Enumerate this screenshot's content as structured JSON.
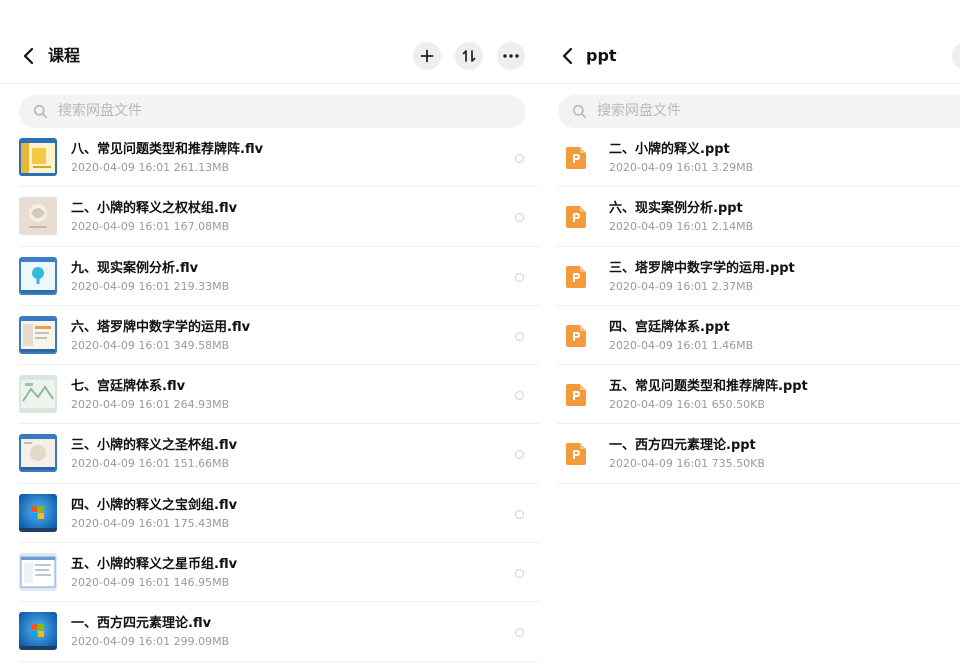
{
  "left": {
    "title": "课程",
    "search_placeholder": "搜索网盘文件",
    "files": [
      {
        "name": "八、常见问题类型和推荐牌阵.flv",
        "date": "2020-04-09",
        "time": "16:01",
        "size": "261.13MB",
        "thumb": "yellow-doc"
      },
      {
        "name": "二、小牌的释义之权杖组.flv",
        "date": "2020-04-09",
        "time": "16:01",
        "size": "167.08MB",
        "thumb": "beige-sketch"
      },
      {
        "name": "九、现实案例分析.flv",
        "date": "2020-04-09",
        "time": "16:01",
        "size": "219.33MB",
        "thumb": "blue-screen"
      },
      {
        "name": "六、塔罗牌中数字学的运用.flv",
        "date": "2020-04-09",
        "time": "16:01",
        "size": "349.58MB",
        "thumb": "window-doc"
      },
      {
        "name": "七、宫廷牌体系.flv",
        "date": "2020-04-09",
        "time": "16:01",
        "size": "264.93MB",
        "thumb": "green-map"
      },
      {
        "name": "三、小牌的释义之圣杯组.flv",
        "date": "2020-04-09",
        "time": "16:01",
        "size": "151.66MB",
        "thumb": "window-doc"
      },
      {
        "name": "四、小牌的释义之宝剑组.flv",
        "date": "2020-04-09",
        "time": "16:01",
        "size": "175.43MB",
        "thumb": "windows7"
      },
      {
        "name": "五、小牌的释义之星币组.flv",
        "date": "2020-04-09",
        "time": "16:01",
        "size": "146.95MB",
        "thumb": "window-list"
      },
      {
        "name": "一、西方四元素理论.flv",
        "date": "2020-04-09",
        "time": "16:01",
        "size": "299.09MB",
        "thumb": "windows7"
      }
    ]
  },
  "right": {
    "title": "ppt",
    "search_placeholder": "搜索网盘文件",
    "files": [
      {
        "name": "二、小牌的释义.ppt",
        "date": "2020-04-09",
        "time": "16:01",
        "size": "3.29MB"
      },
      {
        "name": "六、现实案例分析.ppt",
        "date": "2020-04-09",
        "time": "16:01",
        "size": "2.14MB"
      },
      {
        "name": "三、塔罗牌中数字学的运用.ppt",
        "date": "2020-04-09",
        "time": "16:01",
        "size": "2.37MB"
      },
      {
        "name": "四、宫廷牌体系.ppt",
        "date": "2020-04-09",
        "time": "16:01",
        "size": "1.46MB"
      },
      {
        "name": "五、常见问题类型和推荐牌阵.ppt",
        "date": "2020-04-09",
        "time": "16:01",
        "size": "650.50KB"
      },
      {
        "name": "一、西方四元素理论.ppt",
        "date": "2020-04-09",
        "time": "16:01",
        "size": "735.50KB"
      }
    ]
  },
  "colors": {
    "ppt_orange": "#f39a3d",
    "divider": "#efefef",
    "meta_gray": "#9a9a9a",
    "placeholder_gray": "#b9b9b9"
  },
  "icons": [
    "back-arrow-icon",
    "plus-icon",
    "sort-icon",
    "more-icon",
    "search-icon",
    "ppt-file-icon",
    "select-radio-icon"
  ]
}
